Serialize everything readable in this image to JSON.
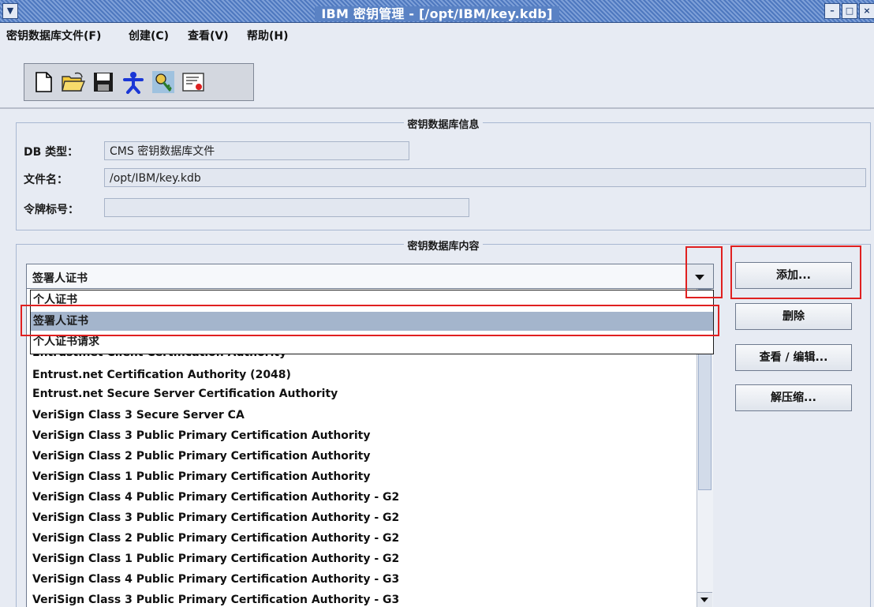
{
  "window": {
    "title": "IBM 密钥管理 - [/opt/IBM/key.kdb]",
    "system_menu_icon": "chevron-down-icon",
    "controls": [
      "minimize",
      "maximize",
      "close"
    ]
  },
  "menu": {
    "items": [
      {
        "label": "密钥数据库文件(F)"
      },
      {
        "label": "创建(C)"
      },
      {
        "label": "查看(V)"
      },
      {
        "label": "帮助(H)"
      }
    ]
  },
  "toolbar": {
    "icons": [
      "new-file-icon",
      "open-folder-icon",
      "save-icon",
      "person-icon",
      "key-icon",
      "certificate-icon"
    ]
  },
  "db_info": {
    "group_title": "密钥数据库信息",
    "db_type_label": "DB 类型：",
    "db_type_value": "CMS 密钥数据库文件",
    "filename_label": "文件名：",
    "filename_value": "/opt/IBM/key.kdb",
    "token_label": "令牌标号：",
    "token_value": ""
  },
  "db_content": {
    "group_title": "密钥数据库内容",
    "combo_selected": "签署人证书",
    "dropdown_options": [
      {
        "label": "个人证书",
        "selected": false
      },
      {
        "label": "签署人证书",
        "selected": true
      },
      {
        "label": "个人证书请求",
        "selected": false
      }
    ],
    "list_items": [
      "Entrust.net Client Certification Authority",
      "Entrust.net Certification Authority (2048)",
      "Entrust.net Secure Server Certification Authority",
      "VeriSign Class 3 Secure Server CA",
      "VeriSign Class 3 Public Primary Certification Authority",
      "VeriSign Class 2 Public Primary Certification Authority",
      "VeriSign Class 1 Public Primary Certification Authority",
      "VeriSign Class 4 Public Primary Certification Authority - G2",
      "VeriSign Class 3 Public Primary Certification Authority - G2",
      "VeriSign Class 2 Public Primary Certification Authority - G2",
      "VeriSign Class 1 Public Primary Certification Authority - G2",
      "VeriSign Class 4 Public Primary Certification Authority - G3",
      "VeriSign Class 3 Public Primary Certification Authority - G3"
    ]
  },
  "buttons": {
    "add": "添加...",
    "delete": "删除",
    "view_edit": "查看 / 编辑...",
    "extract": "解压缩..."
  },
  "highlight_color": "#e02020"
}
